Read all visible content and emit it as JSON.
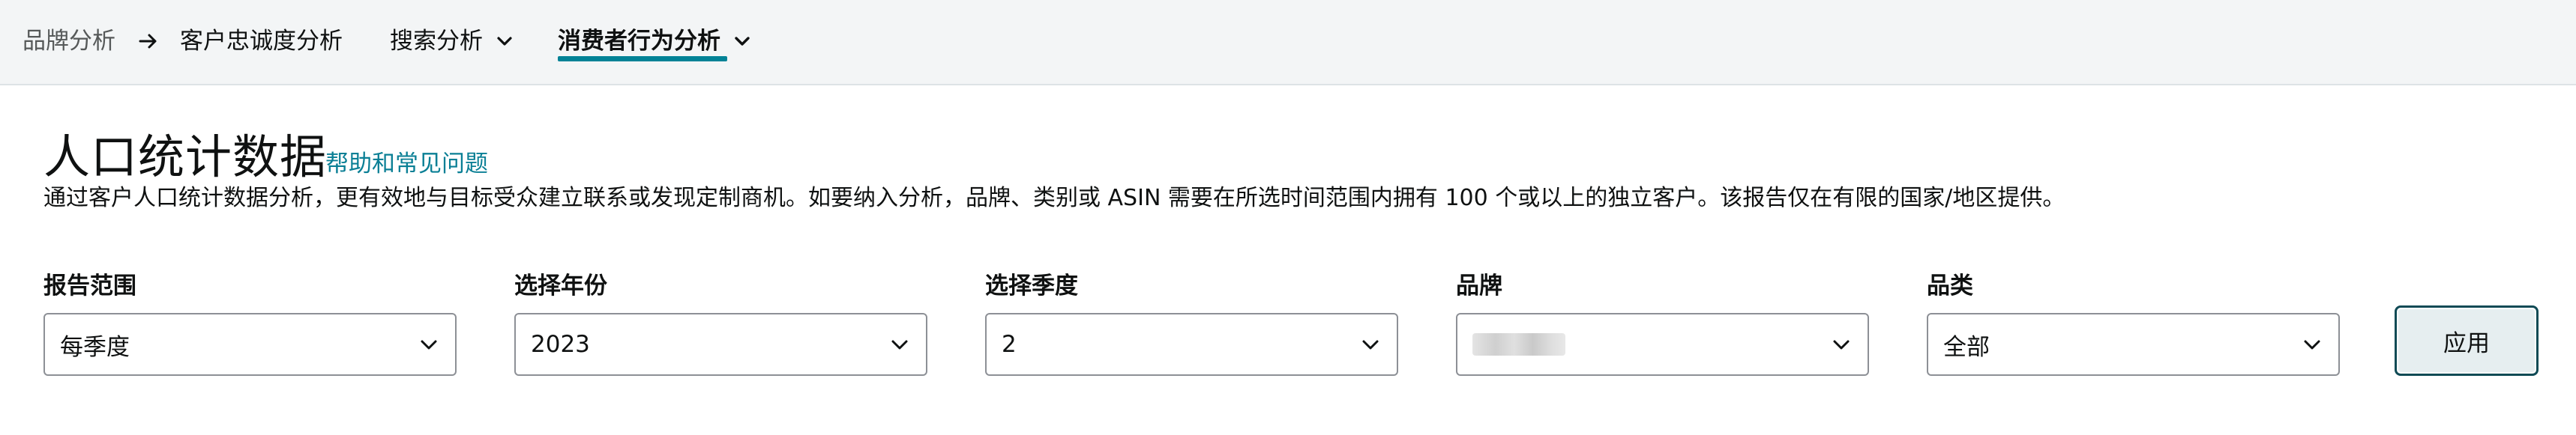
{
  "nav": {
    "breadcrumb_root": "品牌分析",
    "crumb_1": "客户忠诚度分析",
    "crumb_2": "搜索分析",
    "crumb_3": "消费者行为分析"
  },
  "header": {
    "title": "人口统计数据",
    "help_link": "帮助和常见问题",
    "description": "通过客户人口统计数据分析，更有效地与目标受众建立联系或发现定制商机。如要纳入分析，品牌、类别或 ASIN 需要在所选时间范围内拥有 100 个或以上的独立客户。该报告仅在有限的国家/地区提供。"
  },
  "filters": {
    "report_range": {
      "label": "报告范围",
      "value": "每季度"
    },
    "year": {
      "label": "选择年份",
      "value": "2023"
    },
    "quarter": {
      "label": "选择季度",
      "value": "2"
    },
    "brand": {
      "label": "品牌",
      "value": ""
    },
    "category": {
      "label": "品类",
      "value": "全部"
    }
  },
  "actions": {
    "apply_label": "应用"
  },
  "colors": {
    "accent": "#008296",
    "link": "#0a7f95",
    "topbar_bg": "#f3f5f6"
  },
  "icons": [
    "arrow-right-icon",
    "chevron-down-icon"
  ]
}
